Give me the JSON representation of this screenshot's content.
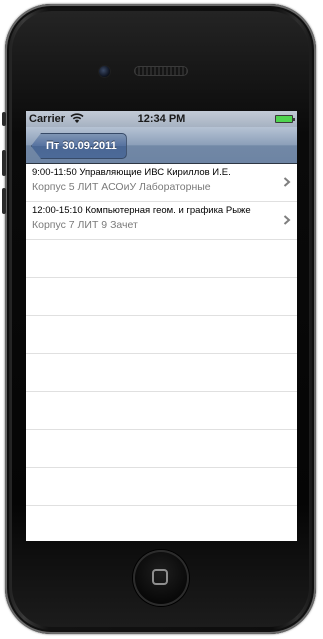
{
  "status_bar": {
    "carrier": "Carrier",
    "time": "12:34 PM",
    "wifi_icon": "wifi-icon",
    "battery_icon": "battery-icon",
    "battery_color": "#4fd44f"
  },
  "navbar": {
    "back_label": "Пт 30.09.2011",
    "tint_color": "#6d84a3"
  },
  "schedule": {
    "rows": [
      {
        "title": "9:00-11:50 Управляющие ИВС Кириллов И.Е.",
        "subtitle": "Корпус 5 ЛИТ АСОиУ Лабораторные",
        "accessory": "chevron-right-icon"
      },
      {
        "title": "12:00-15:10 Компьютерная геом. и графика Рыже",
        "subtitle": "Корпус 7 ЛИТ 9 Зачет",
        "accessory": "chevron-right-icon"
      }
    ],
    "empty_row_count": 9
  },
  "device": {
    "home_button_icon": "home-button-icon"
  }
}
